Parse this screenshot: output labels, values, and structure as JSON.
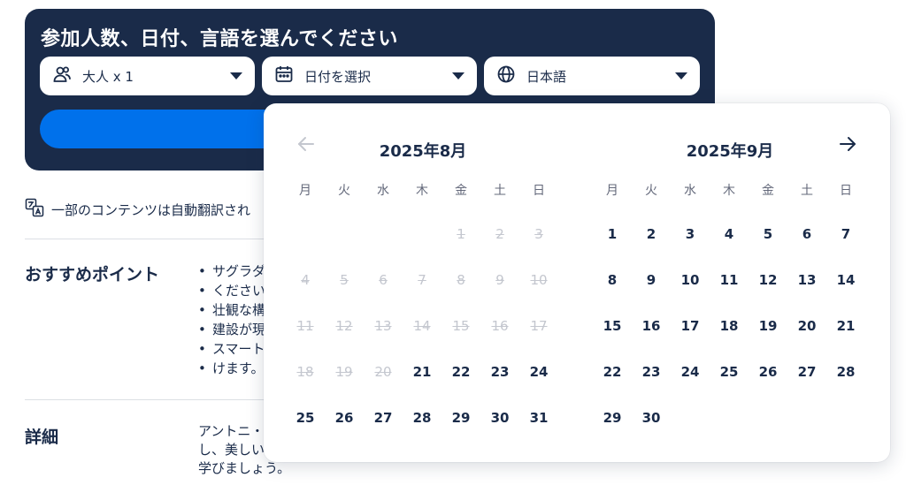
{
  "booking": {
    "title": "参加人数、日付、言語を選んでください",
    "participants_label": "大人 x 1",
    "date_label": "日付を選択",
    "language_label": "日本語"
  },
  "translation_note": "一部のコンテンツは自動翻訳され",
  "highlights": {
    "heading": "おすすめポイント",
    "items": [
      "サグラダ",
      "壮観な構",
      "建設が現",
      "スマート"
    ],
    "continuations": [
      "ください",
      "けます。"
    ]
  },
  "details": {
    "heading": "詳細",
    "lines": [
      "アントニ・",
      "し、美しい",
      "学びましょう。"
    ]
  },
  "calendar": {
    "weekdays": [
      "月",
      "火",
      "水",
      "木",
      "金",
      "土",
      "日"
    ],
    "months": [
      {
        "title": "2025年8月",
        "leading_blanks": 4,
        "days": 31,
        "disabled_through": 20
      },
      {
        "title": "2025年9月",
        "leading_blanks": 0,
        "days": 30,
        "disabled_through": 0
      }
    ]
  },
  "colors": {
    "panel": "#1a2b49",
    "accent": "#0071eb",
    "text": "#1a2b49",
    "disabled": "#c4c7cf"
  },
  "icons": {
    "participants": "people-icon",
    "date": "calendar-icon",
    "language": "globe-icon",
    "translate": "translate-icon",
    "prev": "arrow-left-icon",
    "next": "arrow-right-icon"
  }
}
